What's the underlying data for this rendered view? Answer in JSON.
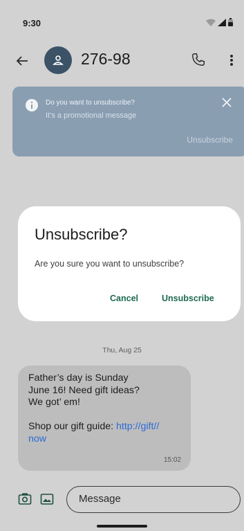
{
  "status_bar": {
    "time": "9:30",
    "icons": [
      "wifi-icon",
      "signal-icon",
      "battery-icon"
    ]
  },
  "app_bar": {
    "back_icon": "arrow-back-icon",
    "avatar_icon": "person-icon",
    "contact_name": "276-98",
    "call_icon": "phone-icon",
    "more_icon": "more-vert-icon"
  },
  "banner": {
    "icon": "info-icon",
    "title": "Do you want to unsubscribe?",
    "subtitle": "It’s a promotional message",
    "close_icon": "close-icon",
    "action_label": "Unsubscribe"
  },
  "dialog": {
    "title": "Unsubscribe?",
    "message": "Are you sure you want to unsubscribe?",
    "cancel_label": "Cancel",
    "confirm_label": "Unsubscribe"
  },
  "conversation": {
    "date": "Thu, Aug 25",
    "messages": [
      {
        "text": "Father’s day is Sunday\nJune 16! Need gift ideas?\nWe got’ em!\n\nShop our gift guide: ",
        "link": "http://gift//\nnow",
        "time": "15:02"
      }
    ]
  },
  "compose": {
    "camera_icon": "camera-icon",
    "gallery_icon": "gallery-icon",
    "placeholder": "Message"
  },
  "colors": {
    "background": "#d2d2d2",
    "banner": "#8a9eb2",
    "avatar": "#3c5266",
    "accent": "#1d6b4e",
    "link": "#2c6bd6",
    "bubble": "#bdbdbd"
  }
}
